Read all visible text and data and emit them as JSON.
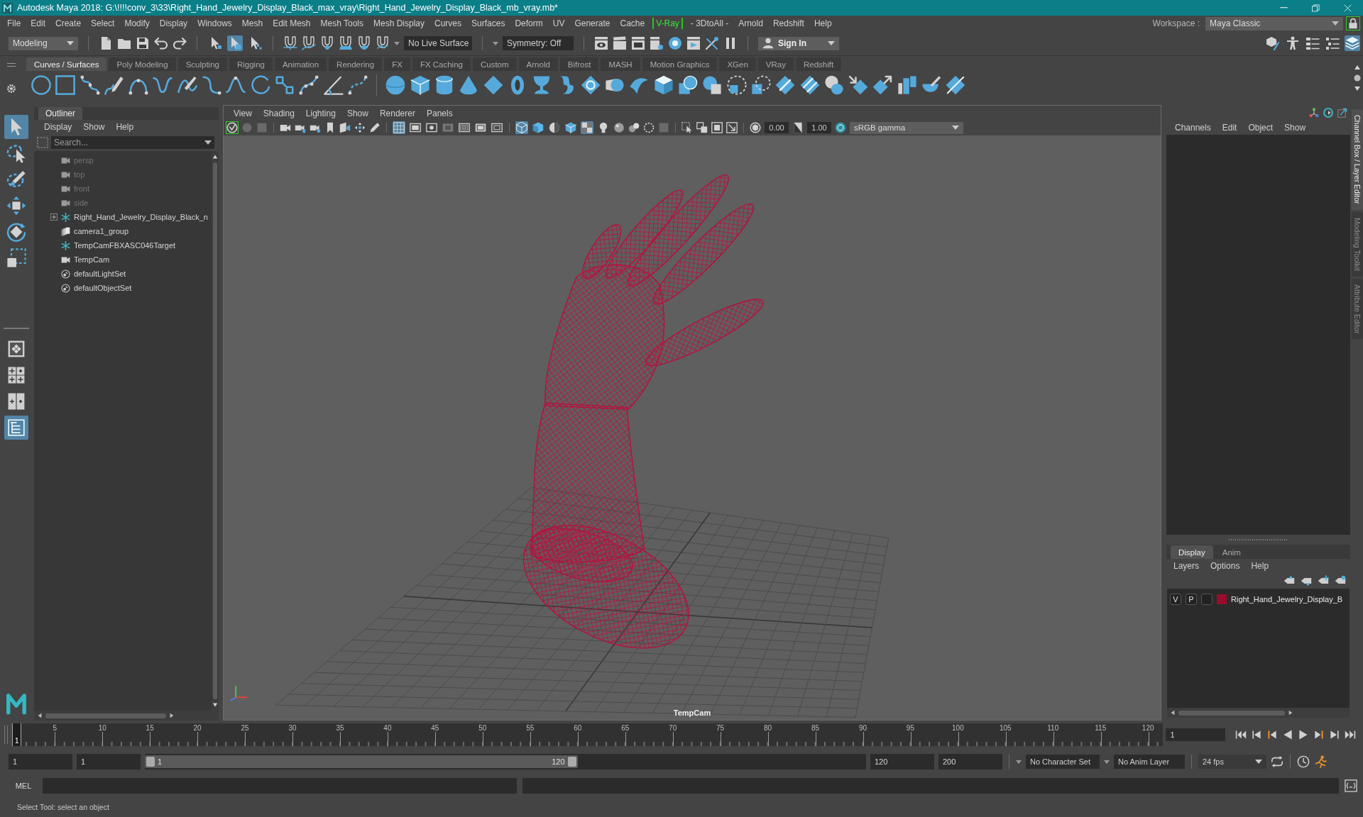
{
  "window": {
    "title": "Autodesk Maya 2018: G:\\!!!!conv_3\\33\\Right_Hand_Jewelry_Display_Black_max_vray\\Right_Hand_Jewelry_Display_Black_mb_vray.mb*"
  },
  "menu_bar": {
    "items": [
      {
        "label": "File",
        "highlighted": false
      },
      {
        "label": "Edit",
        "highlighted": false
      },
      {
        "label": "Create",
        "highlighted": false
      },
      {
        "label": "Select",
        "highlighted": false
      },
      {
        "label": "Modify",
        "highlighted": false
      },
      {
        "label": "Display",
        "highlighted": false
      },
      {
        "label": "Windows",
        "highlighted": false
      },
      {
        "label": "Mesh",
        "highlighted": false
      },
      {
        "label": "Edit Mesh",
        "highlighted": false
      },
      {
        "label": "Mesh Tools",
        "highlighted": false
      },
      {
        "label": "Mesh Display",
        "highlighted": false
      },
      {
        "label": "Curves",
        "highlighted": false
      },
      {
        "label": "Surfaces",
        "highlighted": false
      },
      {
        "label": "Deform",
        "highlighted": false
      },
      {
        "label": "UV",
        "highlighted": false
      },
      {
        "label": "Generate",
        "highlighted": false
      },
      {
        "label": "Cache",
        "highlighted": false
      },
      {
        "label": "V-Ray",
        "highlighted": true
      },
      {
        "label": "- 3DtoAll -",
        "highlighted": false
      },
      {
        "label": "Arnold",
        "highlighted": false
      },
      {
        "label": "Redshift",
        "highlighted": false
      },
      {
        "label": "Help",
        "highlighted": false
      }
    ],
    "workspace_label": "Workspace :",
    "workspace": "Maya Classic"
  },
  "status_line": {
    "mode": "Modeling",
    "selection_modes": [
      {
        "kind": "hierarchy",
        "selected": false
      },
      {
        "kind": "object",
        "selected": true
      },
      {
        "kind": "component",
        "selected": false
      }
    ],
    "live_surface": "No Live Surface",
    "symmetry": "Symmetry: Off",
    "sign_in": "Sign In",
    "panel_toggles": [
      {
        "kind": "modeling_toolkit",
        "selected": false
      },
      {
        "kind": "character_controls",
        "selected": false
      },
      {
        "kind": "attribute_editor",
        "selected": false
      },
      {
        "kind": "tool_settings",
        "selected": false
      },
      {
        "kind": "channel_box",
        "selected": true
      }
    ]
  },
  "shelf": {
    "tabs": [
      {
        "label": "Curves / Surfaces",
        "selected": true
      },
      {
        "label": "Poly Modeling",
        "selected": false
      },
      {
        "label": "Sculpting",
        "selected": false
      },
      {
        "label": "Rigging",
        "selected": false
      },
      {
        "label": "Animation",
        "selected": false
      },
      {
        "label": "Rendering",
        "selected": false
      },
      {
        "label": "FX",
        "selected": false
      },
      {
        "label": "FX Caching",
        "selected": false
      },
      {
        "label": "Custom",
        "selected": false
      },
      {
        "label": "Arnold",
        "selected": false
      },
      {
        "label": "Bifrost",
        "selected": false
      },
      {
        "label": "MASH",
        "selected": false
      },
      {
        "label": "Motion Graphics",
        "selected": false
      },
      {
        "label": "XGen",
        "selected": false
      },
      {
        "label": "VRay",
        "selected": false
      },
      {
        "label": "Redshift",
        "selected": false
      }
    ]
  },
  "toolbox": {
    "tools": [
      {
        "kind": "select",
        "selected": true
      },
      {
        "kind": "lasso",
        "selected": false
      },
      {
        "kind": "paint_select",
        "selected": false
      },
      {
        "kind": "move",
        "selected": false
      },
      {
        "kind": "rotate",
        "selected": false
      },
      {
        "kind": "scale",
        "selected": false
      }
    ],
    "layouts": [
      {
        "kind": "single",
        "selected": false
      },
      {
        "kind": "four",
        "selected": false
      },
      {
        "kind": "two",
        "selected": false
      },
      {
        "kind": "outliner_persp",
        "selected": true
      }
    ]
  },
  "outliner": {
    "title": "Outliner",
    "menus": [
      "Display",
      "Show",
      "Help"
    ],
    "search": {
      "placeholder": "Search..."
    },
    "items": [
      {
        "label": "persp",
        "kind": "camera",
        "dimmed": true,
        "expandable": false
      },
      {
        "label": "top",
        "kind": "camera",
        "dimmed": true,
        "expandable": false
      },
      {
        "label": "front",
        "kind": "camera",
        "dimmed": true,
        "expandable": false
      },
      {
        "label": "side",
        "kind": "camera",
        "dimmed": true,
        "expandable": false
      },
      {
        "label": "Right_Hand_Jewelry_Display_Black_n",
        "kind": "locator",
        "dimmed": false,
        "expandable": true
      },
      {
        "label": "camera1_group",
        "kind": "group",
        "dimmed": false,
        "expandable": false
      },
      {
        "label": "TempCamFBXASC046Target",
        "kind": "locator",
        "dimmed": false,
        "expandable": false
      },
      {
        "label": "TempCam",
        "kind": "camera",
        "dimmed": false,
        "expandable": false
      },
      {
        "label": "defaultLightSet",
        "kind": "set",
        "dimmed": false,
        "expandable": false
      },
      {
        "label": "defaultObjectSet",
        "kind": "set",
        "dimmed": false,
        "expandable": false
      }
    ]
  },
  "viewport": {
    "menus": [
      "View",
      "Shading",
      "Lighting",
      "Show",
      "Renderer",
      "Panels"
    ],
    "display_toggles": [
      {
        "kind": "grid",
        "selected": true
      },
      {
        "kind": "film_gate",
        "selected": false
      },
      {
        "kind": "resolution_gate",
        "selected": false
      },
      {
        "kind": "gate_mask",
        "selected": false
      },
      {
        "kind": "field_chart",
        "selected": false
      },
      {
        "kind": "safe_action",
        "selected": false
      },
      {
        "kind": "safe_title",
        "selected": false
      }
    ],
    "shading_toggles": [
      {
        "kind": "wireframe",
        "selected": true
      },
      {
        "kind": "smooth_shade",
        "selected": false
      },
      {
        "kind": "default_material",
        "selected": false
      },
      {
        "kind": "wireframe_on_shaded",
        "selected": false
      },
      {
        "kind": "xray",
        "selected": true
      },
      {
        "kind": "lights",
        "selected": false
      }
    ],
    "exposure": "0.00",
    "gamma": "1.00",
    "color_space": "sRGB gamma",
    "camera_label": "TempCam"
  },
  "channel_box": {
    "menus": [
      "Channels",
      "Edit",
      "Object",
      "Show"
    ]
  },
  "side_tabs": [
    {
      "label": "Channel Box / Layer Editor",
      "selected": true
    },
    {
      "label": "Modeling Toolkit",
      "selected": false
    },
    {
      "label": "Attribute Editor",
      "selected": false
    }
  ],
  "layer_editor": {
    "tabs": [
      {
        "label": "Display",
        "selected": true
      },
      {
        "label": "Anim",
        "selected": false
      }
    ],
    "menus": [
      "Layers",
      "Options",
      "Help"
    ],
    "layers": [
      {
        "visibility": "V",
        "playback": "P",
        "name": "Right_Hand_Jewelry_Display_B",
        "color": "#9b0b2e"
      }
    ]
  },
  "time_slider": {
    "ticks": [
      "5",
      "10",
      "15",
      "20",
      "25",
      "30",
      "35",
      "40",
      "45",
      "50",
      "55",
      "60",
      "65",
      "70",
      "75",
      "80",
      "85",
      "90",
      "95",
      "100",
      "105",
      "110",
      "115",
      "120"
    ],
    "current_frame": "1",
    "level": 0,
    "frame_field": "1"
  },
  "range_slider": {
    "start": "1",
    "playback_start": "1",
    "range_start": "1",
    "range_end": "120",
    "level": 0.6,
    "playback_end": "120",
    "end": "200",
    "character_set": "No Character Set",
    "anim_layer": "No Anim Layer",
    "fps": "24 fps"
  },
  "command_line": {
    "language": "MEL"
  },
  "help_line": {
    "text": "Select Tool: select an object"
  }
}
